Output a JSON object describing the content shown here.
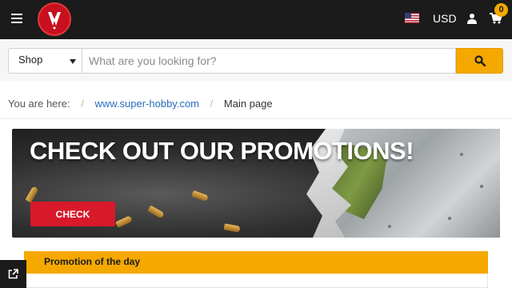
{
  "header": {
    "menu_icon": "hamburger-icon",
    "logo_icon": "super-hobby-logo",
    "currency": "USD",
    "flag_icon": "us-flag-icon",
    "user_icon": "user-icon",
    "cart_icon": "cart-icon",
    "cart_count": "0"
  },
  "search": {
    "category": "Shop",
    "placeholder": "What are you looking for?",
    "value": "",
    "button_icon": "search-icon"
  },
  "breadcrumb": {
    "prefix": "You are here:",
    "items": [
      "www.super-hobby.com",
      "Main page"
    ]
  },
  "banner": {
    "title": "CHECK OUT OUR PROMOTIONS!",
    "button_label": "CHECK"
  },
  "promo_of_day": {
    "title": "Promotion of the day"
  },
  "floating": {
    "external_icon": "external-link-icon"
  },
  "colors": {
    "header_bg": "#1b1b1b",
    "accent": "#f5a800",
    "brand_red": "#d7192a",
    "link": "#2a6ebb"
  }
}
